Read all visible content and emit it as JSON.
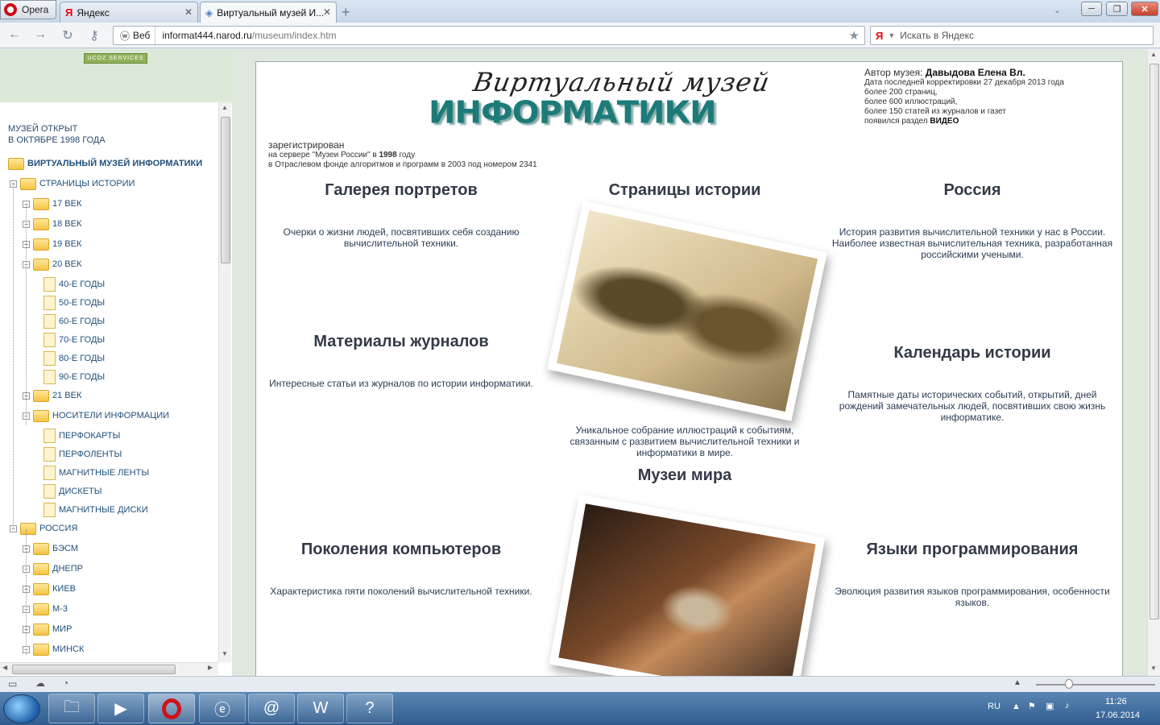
{
  "browser": {
    "opera_label": "Opera",
    "tabs": [
      {
        "label": "Яндекс",
        "active": false
      },
      {
        "label": "Виртуальный музей И...",
        "active": true
      }
    ],
    "address": {
      "mode": "Веб",
      "url_host": "informat444.narod.ru",
      "url_path": "/museum/index.htm"
    },
    "search_placeholder": "Искать в Яндекс",
    "search_engine_glyph": "Я"
  },
  "left": {
    "ucoz": "UCOZ SERVICES",
    "opened_line1": "МУЗЕЙ ОТКРЫТ",
    "opened_line2": "В ОКТЯБРЕ 1998 ГОДА",
    "root": "ВИРТУАЛЬНЫЙ МУЗЕЙ ИНФОРМАТИКИ",
    "tree": [
      {
        "label": "СТРАНИЦЫ ИСТОРИИ",
        "level": 1,
        "kind": "folder"
      },
      {
        "label": "17 ВЕК",
        "level": 2,
        "kind": "folder"
      },
      {
        "label": "18 ВЕК",
        "level": 2,
        "kind": "folder"
      },
      {
        "label": "19 ВЕК",
        "level": 2,
        "kind": "folder"
      },
      {
        "label": "20 ВЕК",
        "level": 2,
        "kind": "folder"
      },
      {
        "label": "40-Е ГОДЫ",
        "level": 3,
        "kind": "doc"
      },
      {
        "label": "50-Е ГОДЫ",
        "level": 3,
        "kind": "doc"
      },
      {
        "label": "60-Е ГОДЫ",
        "level": 3,
        "kind": "doc"
      },
      {
        "label": "70-Е ГОДЫ",
        "level": 3,
        "kind": "doc"
      },
      {
        "label": "80-Е ГОДЫ",
        "level": 3,
        "kind": "doc"
      },
      {
        "label": "90-Е ГОДЫ",
        "level": 3,
        "kind": "doc"
      },
      {
        "label": "21 ВЕК",
        "level": 2,
        "kind": "folder"
      },
      {
        "label": "НОСИТЕЛИ ИНФОРМАЦИИ",
        "level": 2,
        "kind": "folder"
      },
      {
        "label": "ПЕРФОКАРТЫ",
        "level": 3,
        "kind": "doc"
      },
      {
        "label": "ПЕРФОЛЕНТЫ",
        "level": 3,
        "kind": "doc"
      },
      {
        "label": "МАГНИТНЫЕ ЛЕНТЫ",
        "level": 3,
        "kind": "doc"
      },
      {
        "label": "ДИСКЕТЫ",
        "level": 3,
        "kind": "doc"
      },
      {
        "label": "МАГНИТНЫЕ ДИСКИ",
        "level": 3,
        "kind": "doc"
      },
      {
        "label": "РОССИЯ",
        "level": 1,
        "kind": "folder"
      },
      {
        "label": "БЭСМ",
        "level": 2,
        "kind": "folder"
      },
      {
        "label": "ДНЕПР",
        "level": 2,
        "kind": "folder"
      },
      {
        "label": "КИЕВ",
        "level": 2,
        "kind": "folder"
      },
      {
        "label": "М-3",
        "level": 2,
        "kind": "folder"
      },
      {
        "label": "МИР",
        "level": 2,
        "kind": "folder"
      },
      {
        "label": "МИНСК",
        "level": 2,
        "kind": "folder"
      }
    ]
  },
  "main": {
    "logo_script": "Виртуальный музей",
    "logo_main": "ИНФОРМАТИКИ",
    "author_label": "Автор музея:",
    "author_name": "Давыдова Елена Вл.",
    "info": [
      "Дата последней корректировки 27 декабря 2013 года",
      "более 200 страниц,",
      "более 600 иллюстраций,",
      "более 150 статей из журналов и газет"
    ],
    "video_prefix": "появился раздел",
    "video_label": "ВИДЕО",
    "registered": "зарегистрирован",
    "reg_line1_prefix": "на сервере \"Музеи России\" в",
    "reg_year": "1998",
    "reg_line1_suffix": "году",
    "reg_line2": "в Отраслевом фонде алгоритмов и программ в 2003 под номером 2341",
    "sections": {
      "portraits": {
        "title": "Галерея портретов",
        "text": "Очерки о жизни людей, посвятивших себя созданию вычислительной техники."
      },
      "history": {
        "title": "Страницы истории",
        "text": "Уникальное собрание иллюстраций к событиям, связанным с развитием вычислительной техники и информатики в мире."
      },
      "russia": {
        "title": "Россия",
        "text": "История развития вычислительной техники у нас в России. Наиболее известная вычислительная техника, разработанная российскими учеными."
      },
      "journals": {
        "title": "Материалы журналов",
        "text": "Интересные статьи из журналов по истории информатики."
      },
      "calendar": {
        "title": "Календарь истории",
        "text": "Памятные даты исторических событий, открытий, дней рождений замечательных людей, посвятивших свою жизнь информатике."
      },
      "museums": {
        "title": "Музеи мира"
      },
      "generations": {
        "title": "Поколения компьютеров",
        "text": "Характеристика пяти поколений вычислительной техники."
      },
      "languages": {
        "title": "Языки программирования",
        "text": "Эволюция развития языков программирования, особенности языков."
      }
    }
  },
  "taskbar": {
    "lang": "RU",
    "time": "11:26",
    "date": "17.06.2014"
  }
}
